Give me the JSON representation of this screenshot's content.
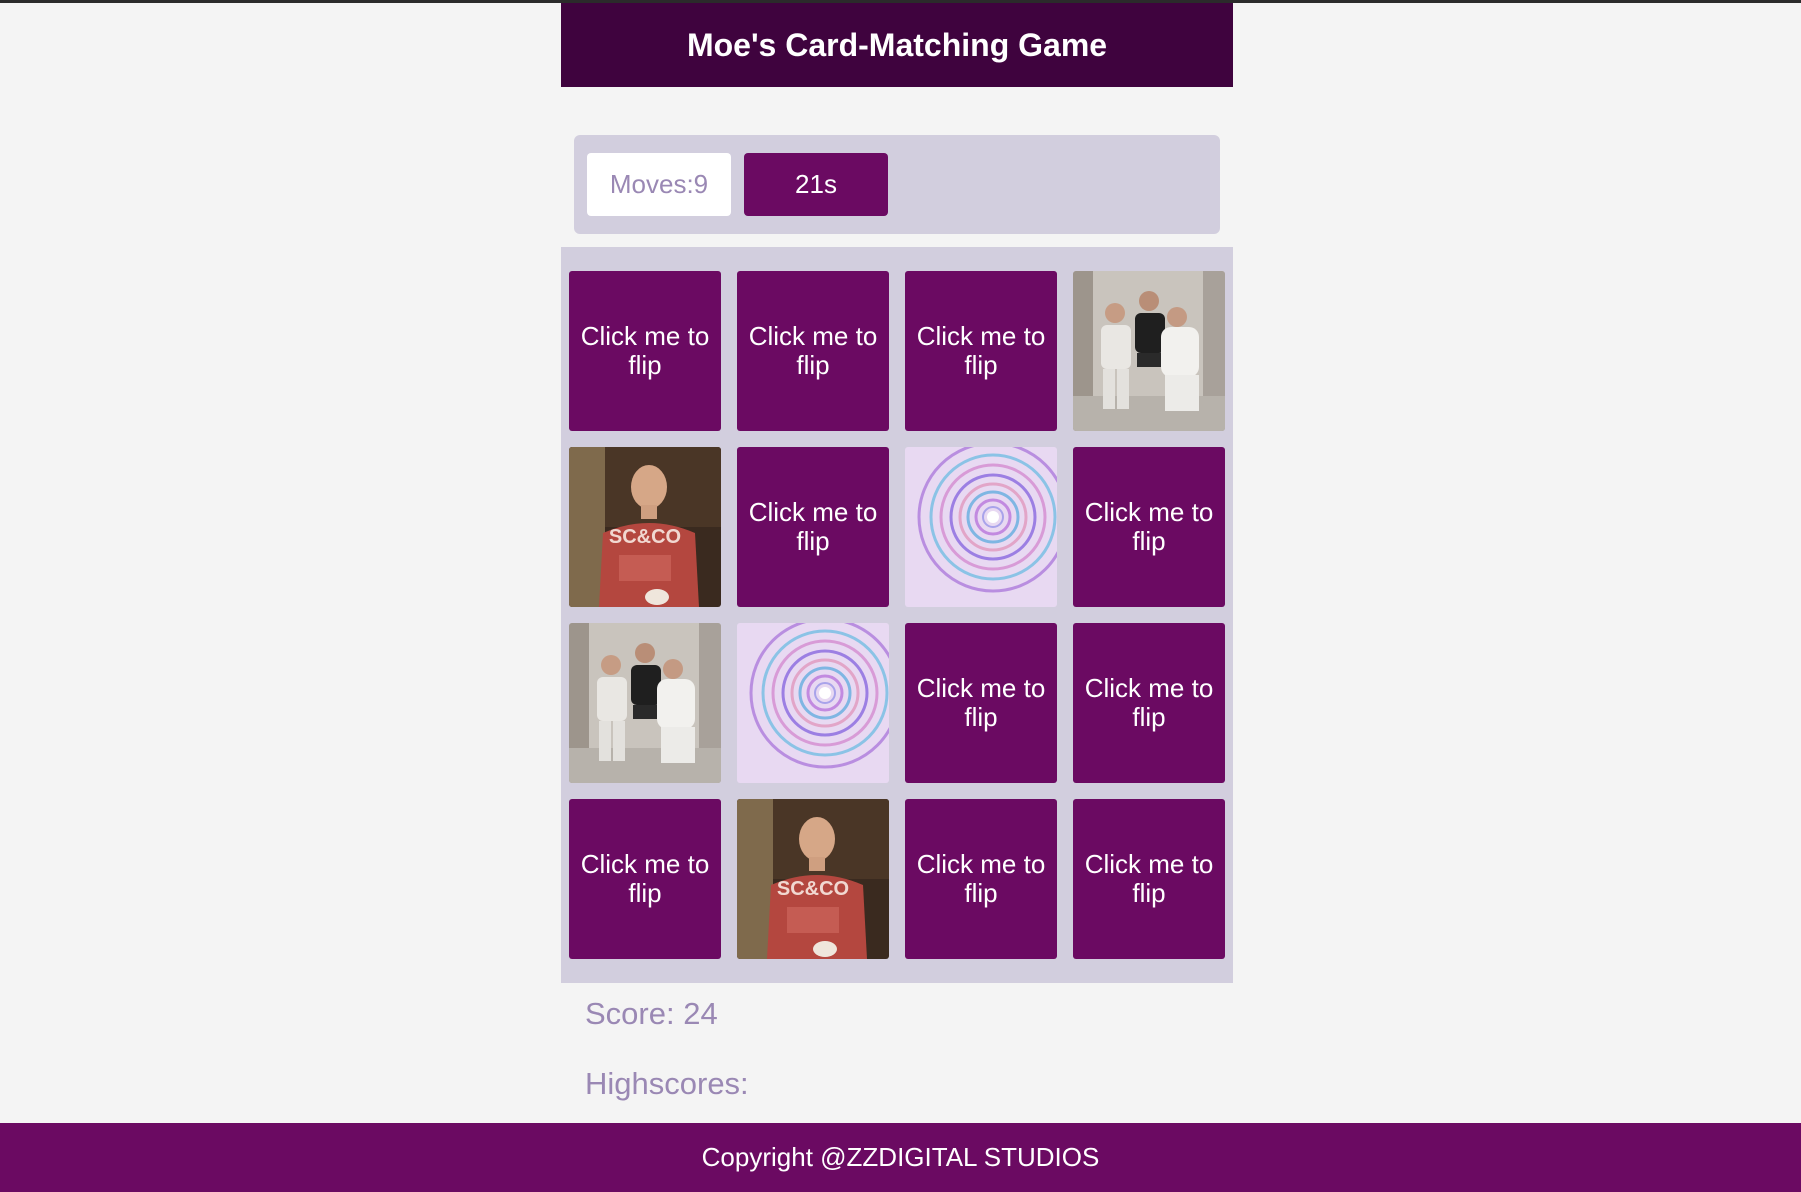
{
  "header": {
    "title": "Moe's Card-Matching Game"
  },
  "stats": {
    "moves_label": "Moves:9",
    "timer_label": "21s"
  },
  "board": {
    "cards": [
      {
        "state": "back",
        "label": "Click me to flip"
      },
      {
        "state": "back",
        "label": "Click me to flip"
      },
      {
        "state": "back",
        "label": "Click me to flip"
      },
      {
        "state": "face",
        "image": "three-men-photo"
      },
      {
        "state": "face",
        "image": "man-red-shirt-photo"
      },
      {
        "state": "back",
        "label": "Click me to flip"
      },
      {
        "state": "face",
        "image": "swirl-tunnel-image"
      },
      {
        "state": "back",
        "label": "Click me to flip"
      },
      {
        "state": "face",
        "image": "three-men-photo"
      },
      {
        "state": "face",
        "image": "swirl-tunnel-image"
      },
      {
        "state": "back",
        "label": "Click me to flip"
      },
      {
        "state": "back",
        "label": "Click me to flip"
      },
      {
        "state": "back",
        "label": "Click me to flip"
      },
      {
        "state": "face",
        "image": "man-red-shirt-photo"
      },
      {
        "state": "back",
        "label": "Click me to flip"
      },
      {
        "state": "back",
        "label": "Click me to flip"
      }
    ]
  },
  "score": {
    "label": "Score: 24"
  },
  "highscores": {
    "label": "Highscores:"
  },
  "footer": {
    "copyright": "Copyright @ZZDIGITAL STUDIOS"
  },
  "colors": {
    "header_bg": "#3f033e",
    "accent": "#6b0a62",
    "panel_bg": "#d2cede",
    "muted_text": "#9a88b4"
  }
}
